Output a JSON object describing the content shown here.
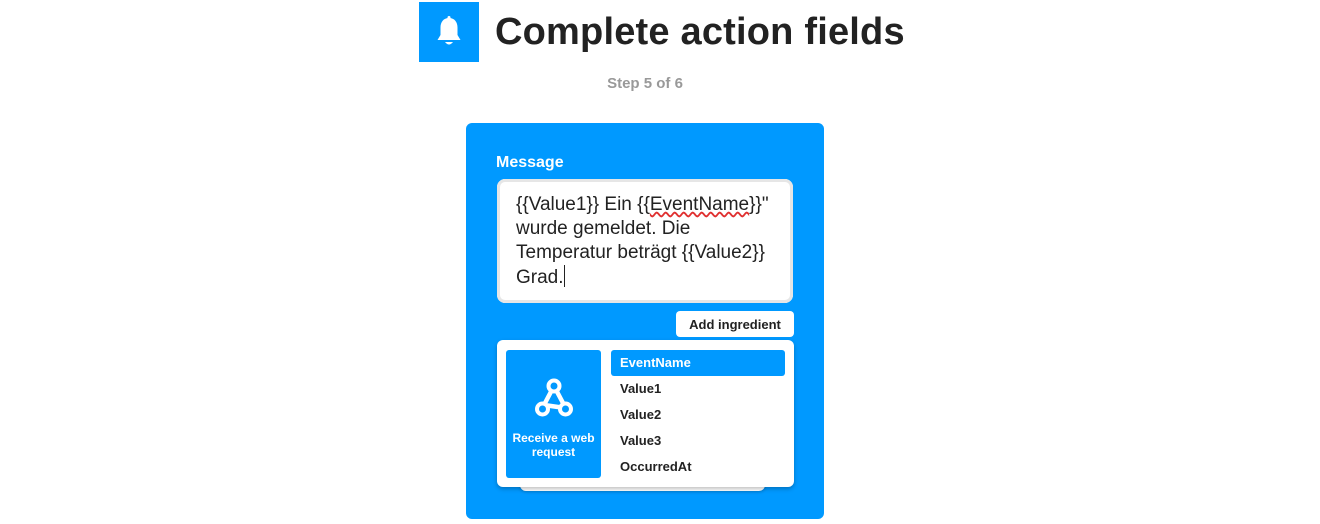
{
  "header": {
    "title": "Complete action fields",
    "icon": "bell-icon",
    "icon_bg": "#0099ff"
  },
  "step": "Step 5 of 6",
  "action_card": {
    "bg_color": "#0099ff",
    "field_label": "Message",
    "message": {
      "part1": "{{Value1}} Ein ",
      "token_open": "{{",
      "token_name": "EventName",
      "token_close": "}}",
      "part2": "\" wurde gemeldet. Die Temperatur beträgt {{Value2}} Grad."
    },
    "add_ingredient_label": "Add ingredient"
  },
  "ingredients_dropdown": {
    "service": {
      "name": "Receive a web request",
      "icon": "webhook-icon"
    },
    "items": [
      {
        "label": "EventName",
        "selected": true
      },
      {
        "label": "Value1",
        "selected": false
      },
      {
        "label": "Value2",
        "selected": false
      },
      {
        "label": "Value3",
        "selected": false
      },
      {
        "label": "OccurredAt",
        "selected": false
      }
    ]
  }
}
